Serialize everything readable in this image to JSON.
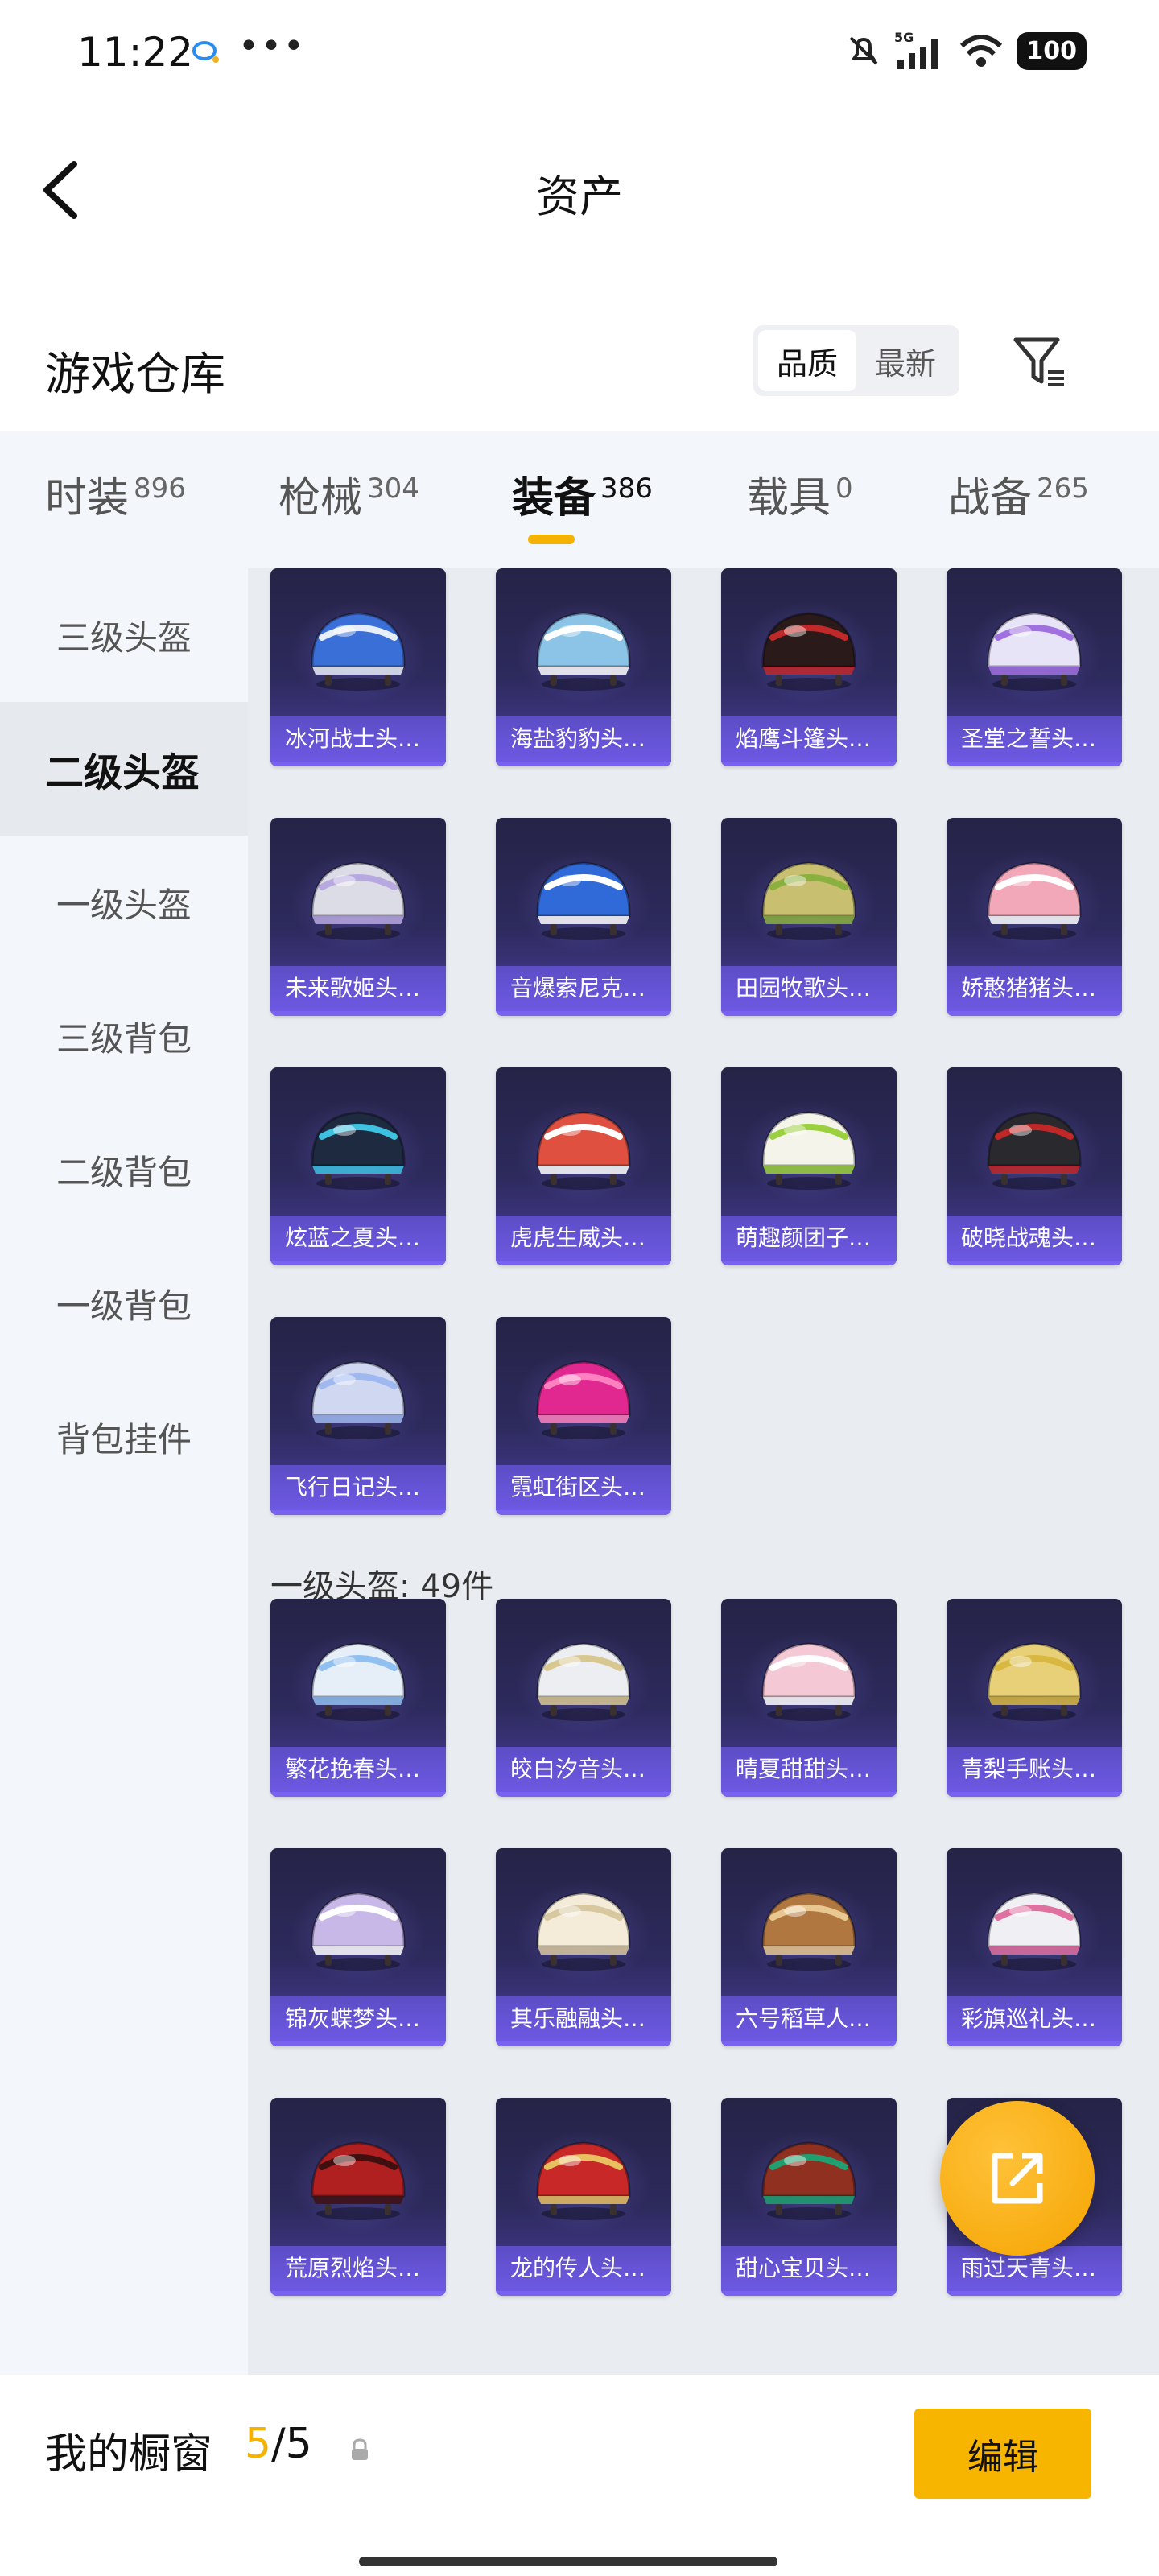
{
  "status_bar": {
    "time": "11:22",
    "dots": "•••",
    "network": "5G",
    "battery": "100"
  },
  "header": {
    "title": "资产"
  },
  "section": {
    "title": "游戏仓库",
    "sort_options": [
      "品质",
      "最新"
    ],
    "active_sort": "品质"
  },
  "tabs": [
    {
      "label": "时装",
      "count": "896"
    },
    {
      "label": "枪械",
      "count": "304"
    },
    {
      "label": "装备",
      "count": "386",
      "active": true
    },
    {
      "label": "载具",
      "count": "0"
    },
    {
      "label": "战备",
      "count": "265"
    }
  ],
  "sidebar": {
    "items": [
      "三级头盔",
      "二级头盔",
      "一级头盔",
      "三级背包",
      "二级背包",
      "一级背包",
      "背包挂件"
    ],
    "active": "二级头盔"
  },
  "group_label": "一级头盔: 49件",
  "items": [
    {
      "name": "冰河战士头…",
      "color": "#3b6fd8",
      "accent": "#e8eef8"
    },
    {
      "name": "海盐豹豹头…",
      "color": "#8cc4e8",
      "accent": "#ffffff"
    },
    {
      "name": "焰鹰斗篷头…",
      "color": "#2a1a1a",
      "accent": "#c0282a"
    },
    {
      "name": "圣堂之誓头…",
      "color": "#e8e4f8",
      "accent": "#a070e0"
    },
    {
      "name": "未来歌姬头…",
      "color": "#dcdce6",
      "accent": "#b8a8e0"
    },
    {
      "name": "音爆索尼克…",
      "color": "#2f6ad8",
      "accent": "#ffffff"
    },
    {
      "name": "田园牧歌头…",
      "color": "#c8c070",
      "accent": "#8ab040"
    },
    {
      "name": "娇憨猪猪头…",
      "color": "#f2a8b8",
      "accent": "#ffffff"
    },
    {
      "name": "炫蓝之夏头…",
      "color": "#1e2a40",
      "accent": "#3ec0e0"
    },
    {
      "name": "虎虎生威头…",
      "color": "#e05040",
      "accent": "#ffffff"
    },
    {
      "name": "萌趣颜团子…",
      "color": "#f4f4ea",
      "accent": "#9bd040"
    },
    {
      "name": "破晓战魂头…",
      "color": "#2a2a2e",
      "accent": "#c02828"
    },
    {
      "name": "飞行日记头…",
      "color": "#cfd8f0",
      "accent": "#a0b8f0"
    },
    {
      "name": "霓虹街区头…",
      "color": "#e02890",
      "accent": "#ff80c0"
    }
  ],
  "items2": [
    {
      "name": "繁花挽春头…",
      "color": "#e6eef8",
      "accent": "#90c0f0"
    },
    {
      "name": "皎白汐音头…",
      "color": "#eceef2",
      "accent": "#d8c890"
    },
    {
      "name": "晴夏甜甜头…",
      "color": "#f4c8d4",
      "accent": "#ffffff"
    },
    {
      "name": "青梨手账头…",
      "color": "#e8d078",
      "accent": "#d8b840"
    },
    {
      "name": "锦灰蝶梦头…",
      "color": "#c8b8e8",
      "accent": "#ffffff"
    },
    {
      "name": "其乐融融头…",
      "color": "#f4ecd8",
      "accent": "#d8c8a0"
    },
    {
      "name": "六号稻草人…",
      "color": "#b07840",
      "accent": "#e8c890"
    },
    {
      "name": "彩旗巡礼头…",
      "color": "#f0f0f4",
      "accent": "#e070a0"
    },
    {
      "name": "荒原烈焰头…",
      "color": "#b02020",
      "accent": "#401010"
    },
    {
      "name": "龙的传人头…",
      "color": "#c82828",
      "accent": "#e8c060"
    },
    {
      "name": "甜心宝贝头…",
      "color": "#903020",
      "accent": "#20a070"
    },
    {
      "name": "雨过天青头…",
      "color": "#88c8d8",
      "accent": "#ffffff"
    }
  ],
  "bottom": {
    "label": "我的橱窗",
    "current": "5",
    "total": "/5",
    "edit": "编辑"
  }
}
